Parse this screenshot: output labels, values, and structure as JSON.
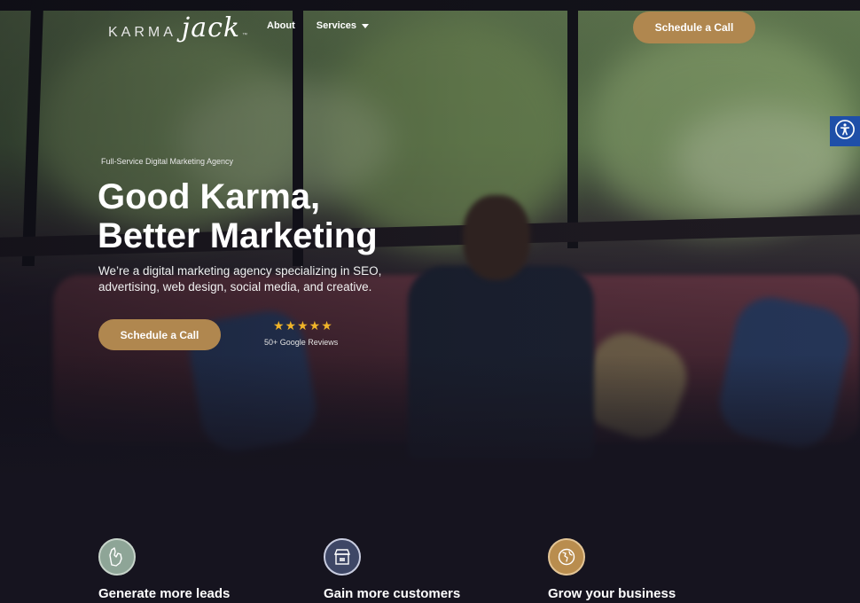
{
  "header": {
    "logo_left": "KARMA",
    "logo_right": "jack",
    "logo_tm": "™",
    "nav": [
      {
        "label": "About"
      },
      {
        "label": "Services"
      }
    ],
    "cta_label": "Schedule a Call"
  },
  "hero": {
    "eyebrow": "Full-Service Digital Marketing Agency",
    "headline_line1": "Good Karma,",
    "headline_line2": "Better Marketing",
    "subtext": "We’re a digital marketing agency specializing in SEO, advertising, web design, social media, and creative.",
    "cta_label": "Schedule a Call",
    "stars": "★★★★★",
    "reviews": "50+ Google Reviews"
  },
  "features": [
    {
      "title": "Generate more leads",
      "icon": "michigan-map-icon"
    },
    {
      "title": "Gain more customers",
      "icon": "storefront-icon"
    },
    {
      "title": "Grow your business",
      "icon": "globe-icon"
    }
  ],
  "colors": {
    "accent": "#b0874f",
    "background": "#16141f",
    "accessibility": "#1f4fa8"
  }
}
